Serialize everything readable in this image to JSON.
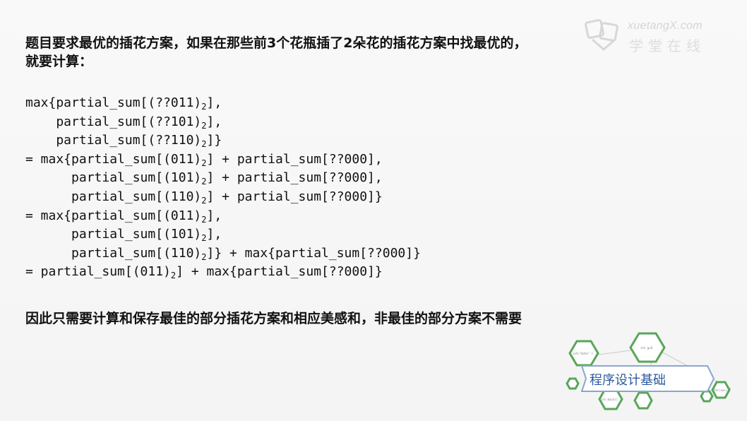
{
  "watermark": {
    "brand_en": "xuetangX.com",
    "brand_cn": "学堂在线"
  },
  "intro": {
    "lines": [
      "题目要求最优的插花方案，如果在那些前3个花瓶插了2朵花的插花方案中找最优的，",
      "就要计算："
    ]
  },
  "code_lines": [
    [
      "max{partial_sum[(??011)",
      "2",
      "],"
    ],
    [
      "    partial_sum[(??101)",
      "2",
      "],"
    ],
    [
      "    partial_sum[(??110)",
      "2",
      "]}"
    ],
    [
      "= max{partial_sum[(011)",
      "2",
      "] + partial_sum[??000],"
    ],
    [
      "      partial_sum[(101)",
      "2",
      "] + partial_sum[??000],"
    ],
    [
      "      partial_sum[(110)",
      "2",
      "] + partial_sum[??000]}"
    ],
    [
      "= max{partial_sum[(011)",
      "2",
      "],"
    ],
    [
      "      partial_sum[(101)",
      "2",
      "],"
    ],
    [
      "      partial_sum[(110)",
      "2",
      "]} + max{partial_sum[??000]}"
    ],
    [
      "= partial_sum[(011)",
      "2",
      "] + max{partial_sum[??000]}"
    ]
  ],
  "conclusion": "因此只需要计算和保存最佳的部分插花方案和相应美感和，非最佳的部分方案不需要",
  "course_badge": {
    "label": "程序设计基础",
    "hex_labels": [
      "int>\"data\" {",
      "int g=0",
      "int main()",
      "for(var=",
      "main()"
    ]
  },
  "colors": {
    "text": "#111111",
    "background": "#f7f7f7",
    "badge_text": "#2b5aa0",
    "hex_green": "#5aa55a"
  }
}
